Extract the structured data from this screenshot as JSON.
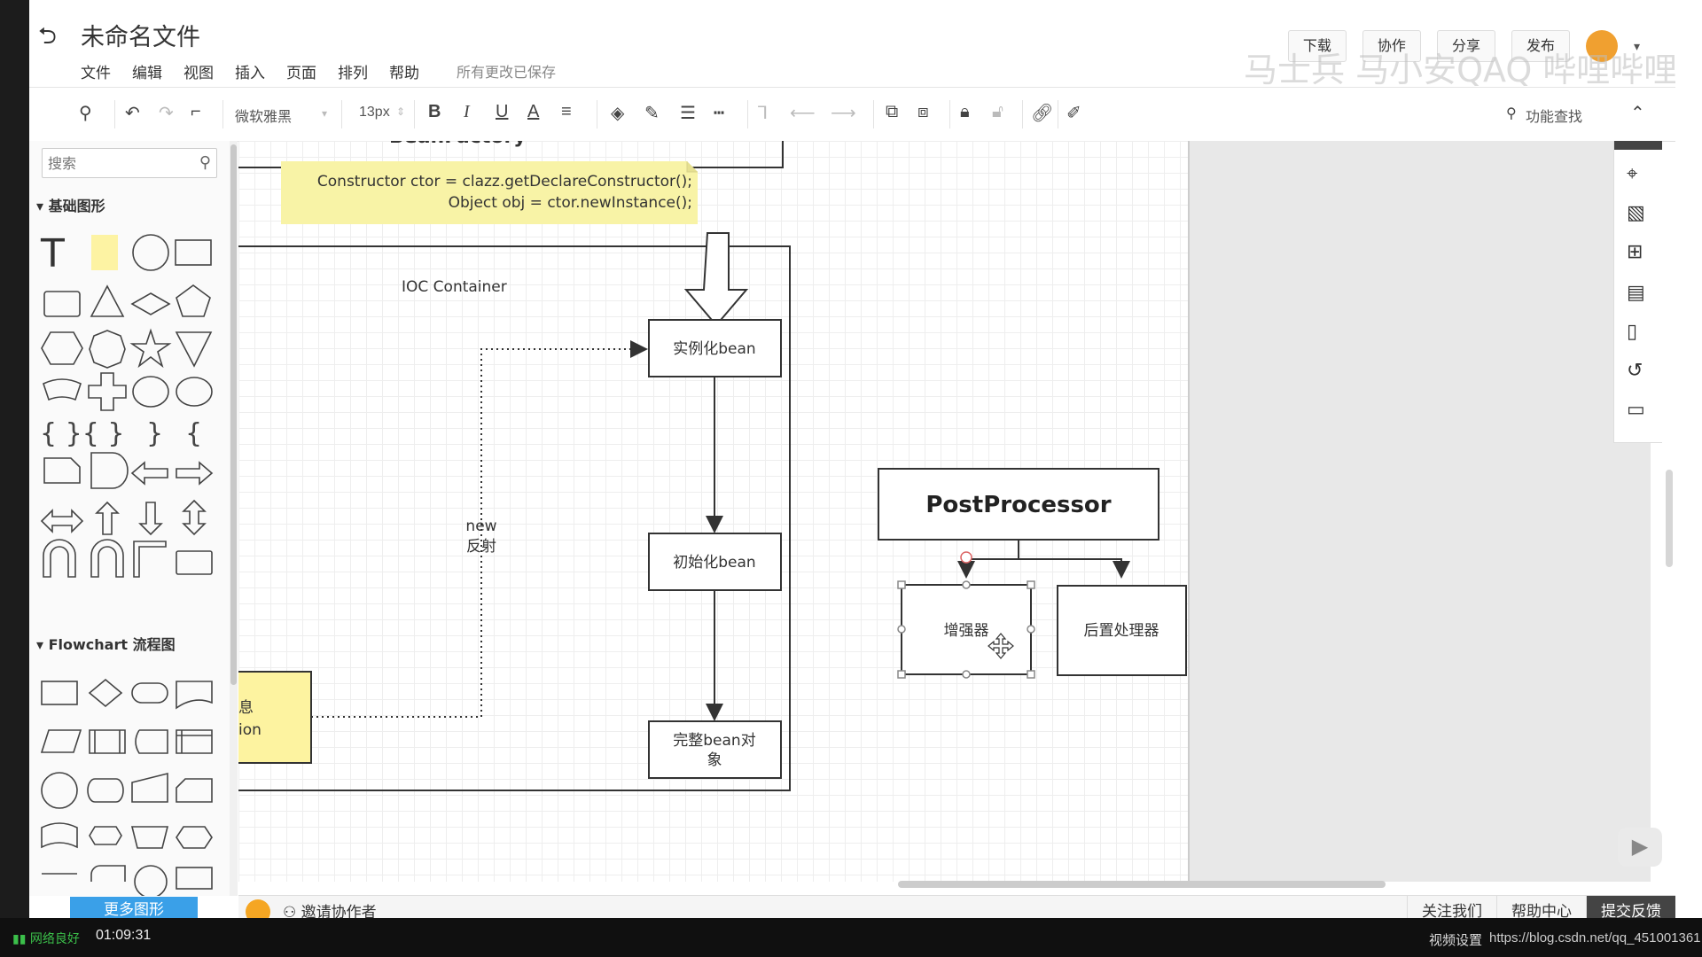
{
  "header": {
    "title": "未命名文件",
    "menu": [
      "文件",
      "编辑",
      "视图",
      "插入",
      "页面",
      "排列",
      "帮助"
    ],
    "saved_status": "所有更改已保存",
    "buttons": {
      "download": "下载",
      "collab": "协作",
      "share": "分享",
      "publish": "发布"
    },
    "watermark": "马士兵 马小安QAQ 哔哩哔哩"
  },
  "toolbar": {
    "font": "微软雅黑",
    "font_size": "13px",
    "bold": "B",
    "italic": "I",
    "underline": "U",
    "font_color": "A",
    "search_fn": "功能查找"
  },
  "left_panel": {
    "search_placeholder": "搜索",
    "section_basic": "基础图形",
    "section_flowchart": "Flowchart 流程图",
    "more_shapes": "更多图形",
    "text_glyph": "T"
  },
  "diagram": {
    "partial_title": "BeanFactory",
    "code_line1": "Constructor ctor = clazz.getDeclareConstructor();",
    "code_line2": "Object obj = ctor.newInstance();",
    "container_label": "IOC  Container",
    "node_instantiate": "实例化bean",
    "node_initialize": "初始化bean",
    "node_complete_line1": "完整bean对",
    "node_complete_line2": "象",
    "edge_label_line1": "new",
    "edge_label_line2": "反射",
    "partial_left_line1": "息",
    "partial_left_line2": "ion",
    "post_processor": "PostProcessor",
    "enhancer": "增强器",
    "post_handler": "后置处理器"
  },
  "bottom_bar": {
    "invite": "邀请协作者",
    "follow": "关注我们",
    "help": "帮助中心",
    "feedback": "提交反馈"
  },
  "video_bar": {
    "network": "网络良好",
    "time": "01:09:31",
    "settings": "视频设置",
    "url": "https://blog.csdn.net/qq_451001361"
  },
  "colors": {
    "accent_blue": "#3aa0e8",
    "note_yellow": "#f8f3a6",
    "selection_handle": "#888888"
  }
}
